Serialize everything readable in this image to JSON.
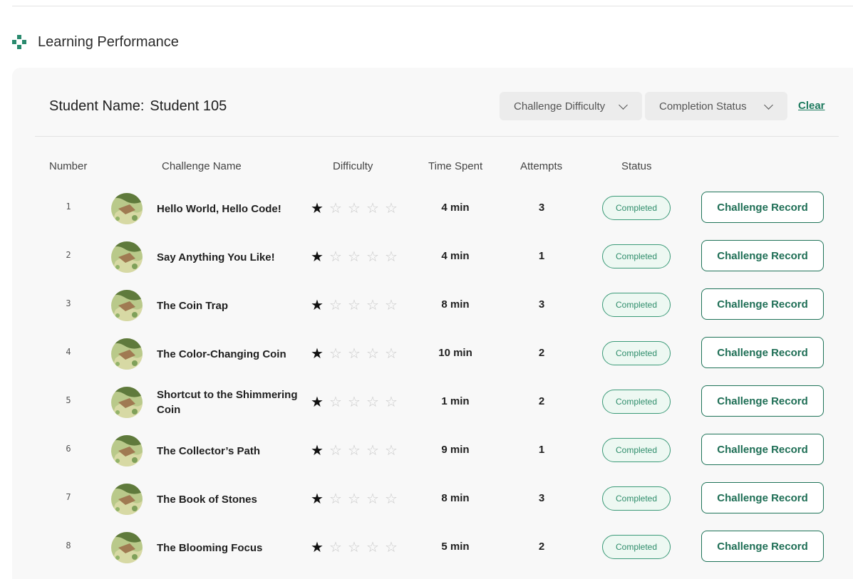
{
  "section": {
    "title": "Learning Performance",
    "icon": "dotted-grid-icon",
    "accent": "#2a8a6e"
  },
  "student": {
    "label": "Student Name:",
    "name": "Student 105"
  },
  "filters": {
    "difficulty": {
      "label": "Challenge Difficulty",
      "icon": "chevron-down-icon"
    },
    "status": {
      "label": "Completion Status",
      "icon": "chevron-down-icon"
    },
    "clear": "Clear"
  },
  "table": {
    "columns": {
      "number": "Number",
      "name": "Challenge Name",
      "difficulty": "Difficulty",
      "time": "Time Spent",
      "attempts": "Attempts",
      "status": "Status"
    },
    "max_stars": 5,
    "record_button": "Challenge Record",
    "rows": [
      {
        "number": "1",
        "name": "Hello World, Hello Code!",
        "difficulty": 1,
        "time": "4 min",
        "attempts": "3",
        "status": "Completed"
      },
      {
        "number": "2",
        "name": "Say Anything You Like!",
        "difficulty": 1,
        "time": "4 min",
        "attempts": "1",
        "status": "Completed"
      },
      {
        "number": "3",
        "name": "The Coin Trap",
        "difficulty": 1,
        "time": "8 min",
        "attempts": "3",
        "status": "Completed"
      },
      {
        "number": "4",
        "name": "The Color-Changing Coin",
        "difficulty": 1,
        "time": "10 min",
        "attempts": "2",
        "status": "Completed"
      },
      {
        "number": "5",
        "name": "Shortcut to the Shimmering Coin",
        "difficulty": 1,
        "time": "1 min",
        "attempts": "2",
        "status": "Completed"
      },
      {
        "number": "6",
        "name": "The Collector’s Path",
        "difficulty": 1,
        "time": "9 min",
        "attempts": "1",
        "status": "Completed"
      },
      {
        "number": "7",
        "name": "The Book of Stones",
        "difficulty": 1,
        "time": "8 min",
        "attempts": "3",
        "status": "Completed"
      },
      {
        "number": "8",
        "name": "The Blooming Focus",
        "difficulty": 1,
        "time": "5 min",
        "attempts": "2",
        "status": "Completed"
      }
    ]
  }
}
